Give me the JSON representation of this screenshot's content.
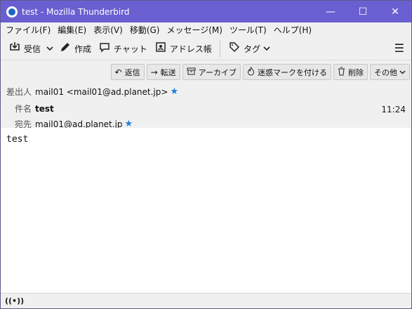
{
  "window": {
    "title": "test - Mozilla Thunderbird",
    "minimize": "—",
    "maximize": "☐",
    "close": "✕"
  },
  "menu": [
    "ファイル(F)",
    "編集(E)",
    "表示(V)",
    "移動(G)",
    "メッセージ(M)",
    "ツール(T)",
    "ヘルプ(H)"
  ],
  "toolbar": {
    "receive": "受信",
    "compose": "作成",
    "chat": "チャット",
    "addressbook": "アドレス帳",
    "tag": "タグ",
    "menu_icon": "☰",
    "receive_icon": "inbox-download-icon",
    "compose_icon": "pencil-icon",
    "chat_icon": "chat-bubble-icon",
    "addressbook_icon": "address-book-icon",
    "tag_icon": "tag-icon"
  },
  "actions": {
    "reply": "返信",
    "forward": "転送",
    "archive": "アーカイブ",
    "junk": "迷惑マークを付ける",
    "delete": "削除",
    "other": "その他"
  },
  "headers": {
    "from_label": "差出人",
    "from_value": "mail01 <mail01@ad.planet.jp>",
    "subject_label": "件名",
    "subject_value": "test",
    "time": "11:24",
    "to_label": "宛先",
    "to_value": "mail01@ad.planet.jp"
  },
  "message": {
    "body": "test"
  },
  "status": {
    "connection_icon": "online-antenna-icon",
    "icon_glyph": "((•))"
  }
}
